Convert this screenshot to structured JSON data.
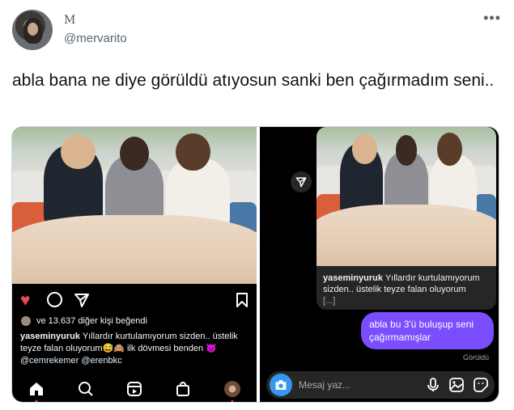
{
  "tweet": {
    "display_name_glyph": "M",
    "handle": "@mervarito",
    "more_label": "•••",
    "text": "abla bana ne diye görüldü atıyosun sanki ben çağırmadım seni.."
  },
  "ig_post": {
    "likes": "ve 13.637 diğer kişi beğendi",
    "caption_user": "yaseminyuruk",
    "caption_text": "Yıllardır kurtulamıyorum sizden.. üstelik teyze falan oluyorum",
    "caption_emoji": "😅🙈",
    "caption_more": "ilk dövmesi benden",
    "caption_mention_emoji": "😈",
    "mention1": "@cemrekemer",
    "mention2": "@erenbkc"
  },
  "ig_dm": {
    "shared_user": "yaseminyuruk",
    "shared_caption": "Yıllardır kurtulamıyorum sizden.. üstelik teyze falan oluyorum",
    "shared_ellipsis": "[...]",
    "message": "abla bu 3'ü buluşup seni çağırmamışlar",
    "seen": "Görüldü",
    "composer_placeholder": "Mesaj yaz..."
  },
  "colors": {
    "instagram_like": "#ed4956",
    "dm_bubble": "#7a4dff",
    "camera_button": "#3797f0"
  },
  "icons": [
    "heart-icon",
    "comment-icon",
    "send-icon",
    "bookmark-icon",
    "home-icon",
    "search-icon",
    "reels-icon",
    "shop-icon",
    "profile-icon",
    "camera-icon",
    "mic-icon",
    "gallery-icon",
    "sticker-icon",
    "more-icon"
  ]
}
